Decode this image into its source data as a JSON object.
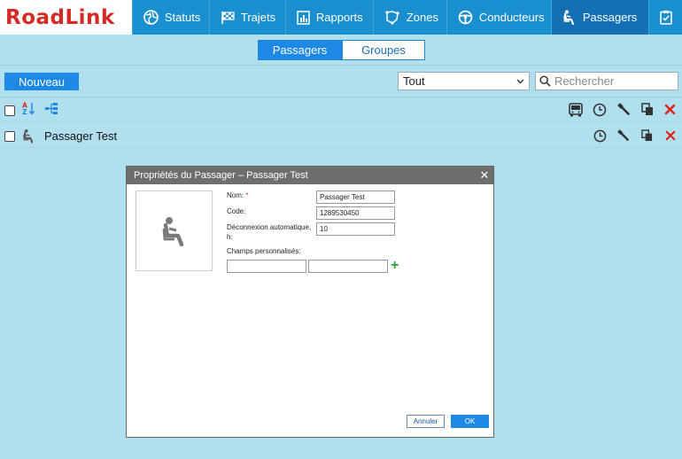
{
  "logo": {
    "part1": "Road",
    "part2": "Link"
  },
  "nav": [
    {
      "id": "statuts",
      "label": "Statuts",
      "icon": "globe-icon"
    },
    {
      "id": "trajets",
      "label": "Trajets",
      "icon": "checkered-flag-icon"
    },
    {
      "id": "rapports",
      "label": "Rapports",
      "icon": "report-icon"
    },
    {
      "id": "zones",
      "label": "Zones",
      "icon": "zone-icon"
    },
    {
      "id": "conducteurs",
      "label": "Conducteurs",
      "icon": "steering-wheel-icon"
    },
    {
      "id": "passagers",
      "label": "Passagers",
      "icon": "seated-passenger-icon",
      "active": true
    },
    {
      "id": "tasks",
      "label": "",
      "icon": "clipboard-check-icon"
    }
  ],
  "tabs": {
    "passagers": "Passagers",
    "groupes": "Groupes"
  },
  "toolbar": {
    "new_label": "Nouveau",
    "filter_value": "Tout",
    "search_placeholder": "Rechercher"
  },
  "list": {
    "header_icons": [
      "sort-az-icon",
      "hierarchy-icon",
      "bus-icon",
      "clock-icon",
      "wrench-icon",
      "copy-icon",
      "delete-icon"
    ],
    "rows": [
      {
        "name": "Passager Test",
        "icons": [
          "clock-icon",
          "wrench-icon",
          "copy-icon",
          "delete-icon"
        ]
      }
    ]
  },
  "dialog": {
    "title": "Propriétés du Passager – Passager Test",
    "close": "✕",
    "fields": {
      "name_label": "Nom:",
      "name_required": "*",
      "name_value": "Passager Test",
      "code_label": "Code:",
      "code_value": "1289530450",
      "logout_label_1": "Déconnexion automatique,",
      "logout_label_2": "h:",
      "logout_value": "10",
      "custom_label": "Champs personnalisés:",
      "custom_key": "",
      "custom_value": ""
    },
    "cancel_label": "Annuler",
    "ok_label": "OK"
  },
  "colors": {
    "accent": "#1e88e5",
    "nav": "#1a8fcf",
    "nav_active": "#1470b5",
    "page_bg": "#b0e0ee",
    "delete": "#e0201b",
    "add": "#2e9e3a",
    "brand": "#d42a26"
  }
}
